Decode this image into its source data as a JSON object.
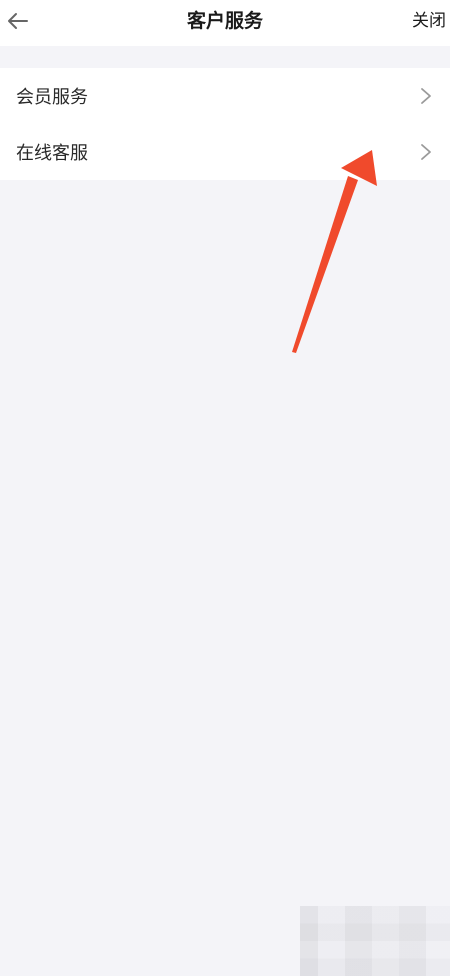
{
  "header": {
    "back_icon": "arrow-left-icon",
    "title": "客户服务",
    "close_label": "关闭"
  },
  "menu": {
    "items": [
      {
        "label": "会员服务",
        "icon": "chevron-right-icon"
      },
      {
        "label": "在线客服",
        "icon": "chevron-right-icon"
      }
    ]
  },
  "annotation": {
    "arrow_color": "#f04a2c",
    "points_to": "在线客服"
  }
}
